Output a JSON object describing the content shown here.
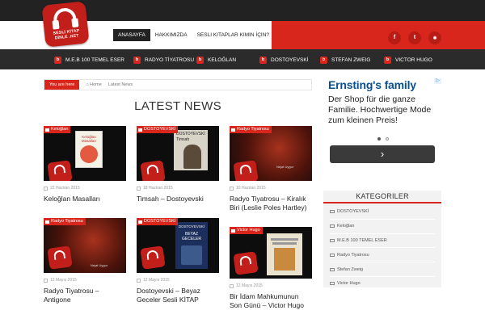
{
  "site": {
    "logo_text": "SESLİ KİTAP DİNLE .NET"
  },
  "mainnav": {
    "items": [
      "ANASAYFA",
      "HAKKIMIZDA",
      "SESLI KITAPLAR KIMIN İÇIN?"
    ]
  },
  "social": [
    "f",
    "t",
    "rss"
  ],
  "catnav": {
    "items": [
      "M.E.B 100 TEMEL ESER",
      "RADYO TİYATROSU",
      "KELOĞLAN",
      "DOSTOYEVSKİ",
      "STEFAN ZWEIG",
      "VICTOR HUGO"
    ]
  },
  "breadcrumb": {
    "here": "You are here",
    "home": "Home",
    "current": "Latest News"
  },
  "section_title": "LATEST NEWS",
  "posts": [
    {
      "tag": "Keloğlan",
      "date": "22 Haziran 2015",
      "title": "Keloğlan Masalları"
    },
    {
      "tag": "DOSTOYEVSKİ",
      "date": "18 Haziran 2015",
      "title": "Timsah – Dostoyevski"
    },
    {
      "tag": "Radyo Tiyatrosu",
      "date": "10 Haziran 2015",
      "title": "Radyo Tiyatrosu – Kiralık Biri (Leslie Poles Hartley)"
    },
    {
      "tag": "Radyo Tiyatrosu",
      "date": "12 Mayıs 2015",
      "title": "Radyo Tiyatrosu – Antigone"
    },
    {
      "tag": "DOSTOYEVSKİ",
      "date": "12 Mayıs 2015",
      "title": "Dostoyevski – Beyaz Geceler Sesli KİTAP"
    },
    {
      "tag": "Victor Hugo",
      "date": "12 Mayıs 2015",
      "title": "Bir İdam Mahkumunun Son Günü – Victor Hugo"
    }
  ],
  "thumb_texts": {
    "keloglan_cover": "Keloğlan Masalları",
    "timsah_author": "DOSTOYEVSKİ",
    "timsah_title": "Timsah",
    "beyaz_author": "DOSTOYEVSKİ",
    "beyaz_title": "BEYAZ GECELER",
    "nejat": "Nejat Uygur"
  },
  "ad": {
    "headline": "Ernsting's family",
    "text": "Der Shop für die ganze Familie. Hochwertige Mode zum kleinen Preis!",
    "button": "›"
  },
  "sidebar": {
    "title": "KATEGORILER",
    "items": [
      "DOSTOYEVSKİ",
      "Keloğlan",
      "M.E.B 100 TEMEL ESER",
      "Radyo Tiyatrosu",
      "Stefan Zweig",
      "Victor Hugo"
    ]
  },
  "colors": {
    "accent": "#d9261c",
    "dark": "#222222",
    "ad_brand": "#0a4f8f"
  }
}
